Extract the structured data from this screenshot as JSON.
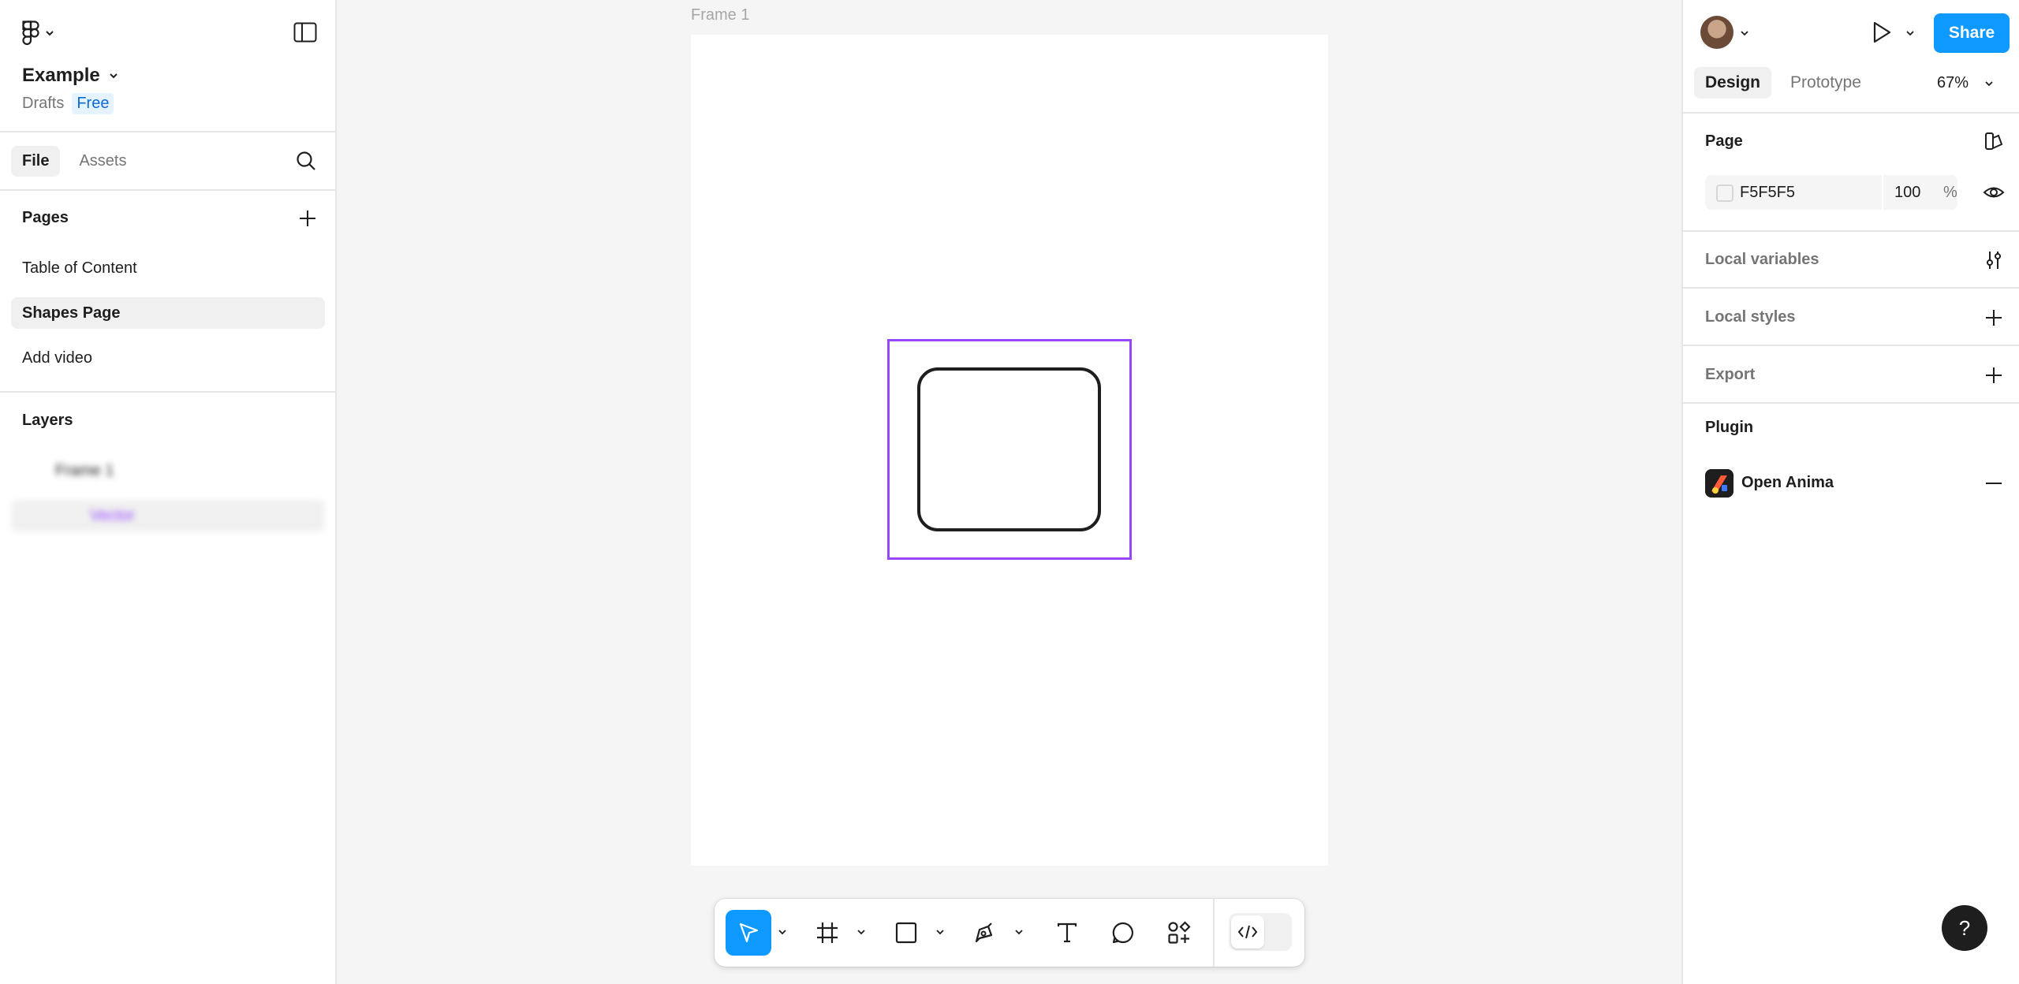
{
  "file": {
    "name": "Example",
    "location": "Drafts",
    "plan": "Free"
  },
  "left_tabs": [
    {
      "label": "File",
      "active": true
    },
    {
      "label": "Assets",
      "active": false
    }
  ],
  "pages": {
    "title": "Pages",
    "items": [
      {
        "label": "Table of Content",
        "active": false
      },
      {
        "label": "Shapes Page",
        "active": true
      },
      {
        "label": "Add video",
        "active": false
      }
    ]
  },
  "layers": {
    "title": "Layers",
    "items": [
      {
        "label": "Frame 1"
      },
      {
        "label": "Vector"
      }
    ]
  },
  "canvas": {
    "frame_label": "Frame 1"
  },
  "right": {
    "share_label": "Share",
    "tabs": [
      {
        "label": "Design",
        "active": true
      },
      {
        "label": "Prototype",
        "active": false
      }
    ],
    "zoom": "67%",
    "page_section": "Page",
    "page_color_hex": "F5F5F5",
    "page_opacity": "100",
    "page_opacity_unit": "%",
    "local_variables": "Local variables",
    "local_styles": "Local styles",
    "export": "Export",
    "plugin_section": "Plugin",
    "plugin_name": "Open Anima"
  },
  "help_label": "?",
  "colors": {
    "accent": "#0d99ff",
    "selection": "#9747ff",
    "canvas_bg": "#f5f5f5"
  }
}
